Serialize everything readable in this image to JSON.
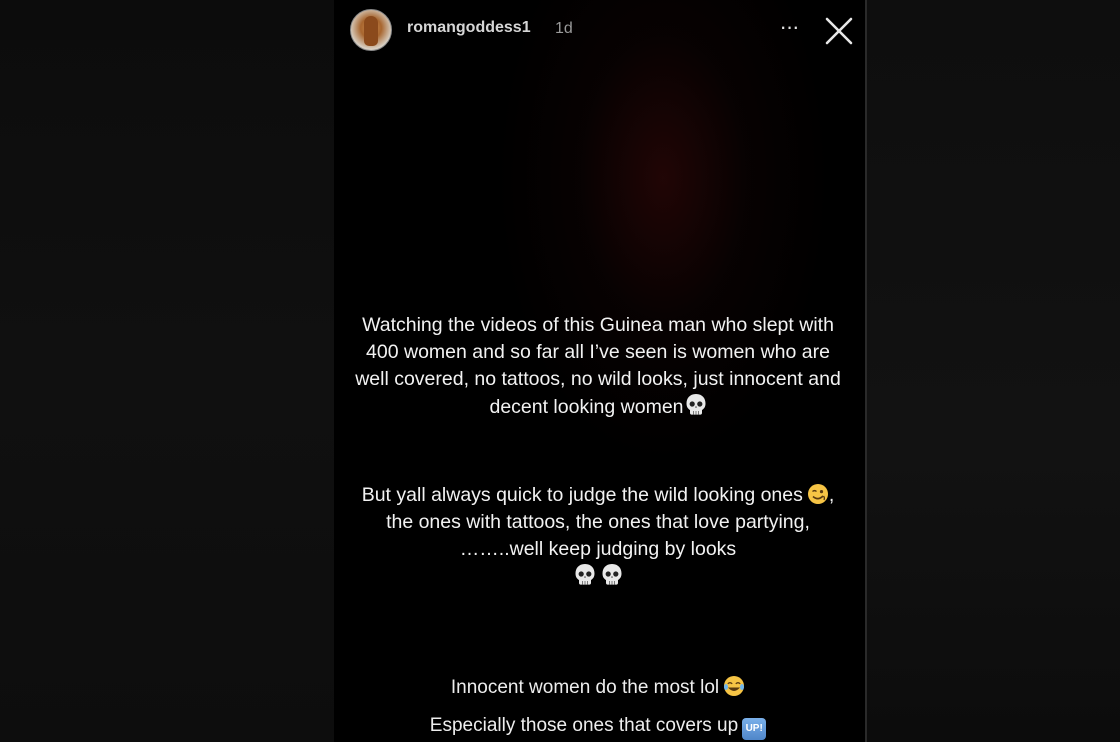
{
  "story": {
    "username": "romangoddess1",
    "timestamp": "1d",
    "more_label": "···",
    "paragraph1": "Watching the videos of this Guinea man who slept with 400 women and so far all I’ve seen is women who are well covered, no tattoos, no wild looks, just innocent and decent looking women",
    "paragraph2_part1": "But yall always quick to judge the wild looking ones",
    "paragraph2_part2": ", the ones with tattoos, the ones that love partying, ……..well keep judging by looks",
    "line3": "Innocent women do the most lol",
    "line4": "Especially those ones that covers up",
    "up_badge": "UP!"
  },
  "icons": {
    "avatar": "profile-avatar",
    "more": "more-options-icon",
    "close": "close-icon",
    "skull": "skull-emoji-icon",
    "wink": "winking-face-emoji-icon",
    "laugh": "tears-of-joy-emoji-icon",
    "up": "up-button-emoji-icon"
  },
  "colors": {
    "background": "#000000",
    "text": "#f2f2f2",
    "username": "#d6d6d6",
    "timestamp": "#9a9a9a",
    "up_badge": "#5b8fd0"
  }
}
